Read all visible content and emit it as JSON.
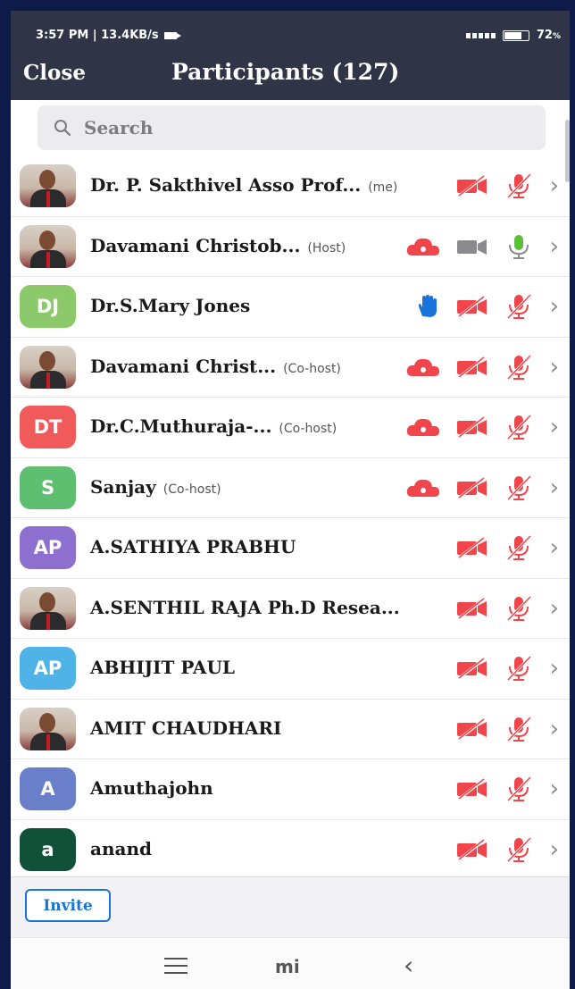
{
  "status_bar": {
    "time_rate": "3:57 PM | 13.4KB/s",
    "battery": "72"
  },
  "header": {
    "close_label": "Close",
    "title": "Participants (127)"
  },
  "search": {
    "placeholder": "Search"
  },
  "participants": [
    {
      "name": "Dr. P. Sakthivel Asso Prof...",
      "tag": "(me)",
      "avatar": "photo",
      "cloud": false,
      "hand": false,
      "video": "off",
      "mic": "muted"
    },
    {
      "name": "Davamani Christob...",
      "tag": "(Host)",
      "avatar": "photo",
      "cloud": true,
      "hand": false,
      "video": "on",
      "mic": "on"
    },
    {
      "name": "Dr.S.Mary Jones",
      "tag": "",
      "avatar": "initials",
      "initials": "DJ",
      "color": "#8cc96a",
      "cloud": false,
      "hand": true,
      "video": "off",
      "mic": "muted"
    },
    {
      "name": "Davamani Christ...",
      "tag": "(Co-host)",
      "avatar": "photo",
      "cloud": true,
      "hand": false,
      "video": "off",
      "mic": "muted"
    },
    {
      "name": "Dr.C.Muthuraja-...",
      "tag": "(Co-host)",
      "avatar": "initials",
      "initials": "DT",
      "color": "#f05a5a",
      "cloud": true,
      "hand": false,
      "video": "off",
      "mic": "muted"
    },
    {
      "name": "Sanjay",
      "tag": "(Co-host)",
      "avatar": "initials",
      "initials": "S",
      "color": "#5fbf70",
      "cloud": true,
      "hand": false,
      "video": "off",
      "mic": "muted"
    },
    {
      "name": "A.SATHIYA PRABHU",
      "tag": "",
      "avatar": "initials",
      "initials": "AP",
      "color": "#8d6fcf",
      "cloud": false,
      "hand": false,
      "video": "off",
      "mic": "muted"
    },
    {
      "name": "A.SENTHIL RAJA Ph.D Resea...",
      "tag": "",
      "avatar": "photo",
      "cloud": false,
      "hand": false,
      "video": "off",
      "mic": "muted"
    },
    {
      "name": "ABHIJIT PAUL",
      "tag": "",
      "avatar": "initials",
      "initials": "AP",
      "color": "#4fb3e8",
      "cloud": false,
      "hand": false,
      "video": "off",
      "mic": "muted"
    },
    {
      "name": "AMIT CHAUDHARI",
      "tag": "",
      "avatar": "photo",
      "cloud": false,
      "hand": false,
      "video": "off",
      "mic": "muted"
    },
    {
      "name": "Amuthajohn",
      "tag": "",
      "avatar": "initials",
      "initials": "A",
      "color": "#6a7fc9",
      "cloud": false,
      "hand": false,
      "video": "off",
      "mic": "muted"
    },
    {
      "name": "anand",
      "tag": "",
      "avatar": "initials",
      "initials": "a",
      "color": "#11513a",
      "cloud": false,
      "hand": false,
      "video": "off",
      "mic": "muted"
    }
  ],
  "footer": {
    "invite_label": "Invite"
  },
  "navbar": {
    "center_label": "mi"
  },
  "colors": {
    "red": "#f0454a",
    "green": "#5cbf3a",
    "blue": "#1a73d8",
    "gray": "#8d8d92"
  }
}
